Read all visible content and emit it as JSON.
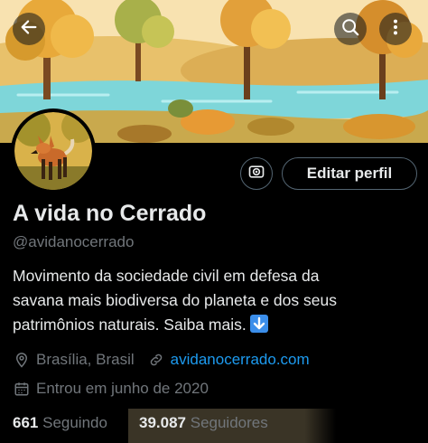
{
  "header": {
    "back_icon": "arrow-left-icon",
    "search_icon": "search-icon",
    "more_icon": "more-vertical-icon"
  },
  "banner": {
    "description": "illustrated-forest-landscape-banner",
    "colors": {
      "sky": "#f6d89a",
      "water": "#7ed6d9",
      "grass": "#c9b25a",
      "tree": "#e8a93a"
    }
  },
  "profile": {
    "avatar_icon": "maned-wolf-avatar",
    "name": "A vida no Cerrado",
    "handle": "@avidanocerrado",
    "bio_lines": [
      "Movimento da sociedade civil em defesa da",
      "savana mais biodiversa do planeta e dos seus",
      "patrimônios naturais. Saiba mais."
    ],
    "bio_emoji_icon": "down-arrow-emoji-icon",
    "location": "Brasília, Brasil",
    "website": "avidanocerrado.com",
    "joined": "Entrou em junho de 2020"
  },
  "actions": {
    "notifications_icon": "bell-subscribe-icon",
    "edit_label": "Editar perfil"
  },
  "stats": {
    "following_count": "661",
    "following_label": "Seguindo",
    "followers_count": "39.087",
    "followers_label": "Seguidores"
  },
  "colors": {
    "background": "#000000",
    "text": "#e7e9ea",
    "muted": "#71767b",
    "link": "#1d9bf0",
    "border": "#536471"
  }
}
